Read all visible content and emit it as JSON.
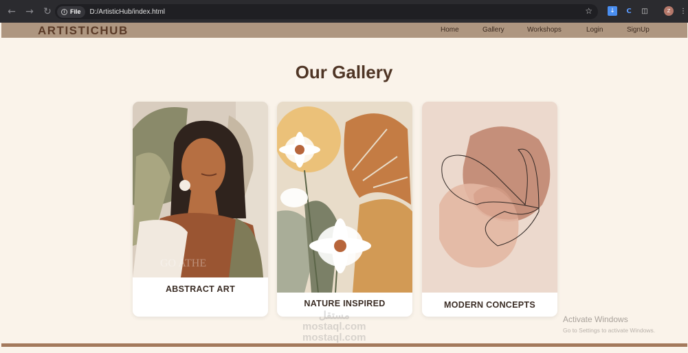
{
  "browser": {
    "back_icon": "arrow-left-icon",
    "forward_icon": "arrow-right-icon",
    "reload_icon": "reload-icon",
    "scheme_chip": "File",
    "url": "D:/ArtisticHub/index.html",
    "profile_initial": "Z"
  },
  "site": {
    "logo": "ARTISTICHUB",
    "nav": [
      "Home",
      "Gallery",
      "Workshops",
      "Login",
      "SignUp"
    ]
  },
  "gallery": {
    "title": "Our Gallery",
    "cards": [
      {
        "label": "ABSTRACT ART",
        "art_watermark": "GO ATHE"
      },
      {
        "label": "NATURE INSPIRED"
      },
      {
        "label": "MODERN CONCEPTS"
      }
    ]
  },
  "os_overlay": {
    "activate_title": "Activate Windows",
    "activate_sub": "Go to Settings to activate Windows."
  },
  "watermark": {
    "arabic": "مستقل",
    "line1": "mostaql.com",
    "line2": "mostaql.com"
  },
  "colors": {
    "page_bg": "#faf3ea",
    "nav_bg": "#ae9680",
    "logo": "#5a3a27",
    "accent_bar": "#a3795c"
  }
}
